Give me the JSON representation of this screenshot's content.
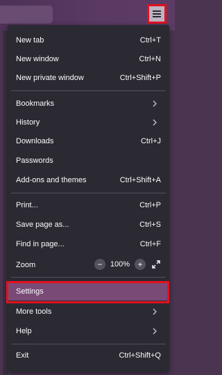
{
  "colors": {
    "accent_highlight": "#e5101e",
    "menu_bg": "#2b2a33",
    "selected_bg": "#7a4a77"
  },
  "toolbar": {
    "menu_icon": "hamburger-menu-icon"
  },
  "menu": {
    "new_tab": {
      "label": "New tab",
      "shortcut": "Ctrl+T"
    },
    "new_window": {
      "label": "New window",
      "shortcut": "Ctrl+N"
    },
    "new_private_window": {
      "label": "New private window",
      "shortcut": "Ctrl+Shift+P"
    },
    "bookmarks": {
      "label": "Bookmarks"
    },
    "history": {
      "label": "History"
    },
    "downloads": {
      "label": "Downloads",
      "shortcut": "Ctrl+J"
    },
    "passwords": {
      "label": "Passwords"
    },
    "addons": {
      "label": "Add-ons and themes",
      "shortcut": "Ctrl+Shift+A"
    },
    "print": {
      "label": "Print...",
      "shortcut": "Ctrl+P"
    },
    "save_page": {
      "label": "Save page as...",
      "shortcut": "Ctrl+S"
    },
    "find": {
      "label": "Find in page...",
      "shortcut": "Ctrl+F"
    },
    "zoom": {
      "label": "Zoom",
      "minus": "−",
      "value": "100%",
      "plus": "+"
    },
    "settings": {
      "label": "Settings"
    },
    "more_tools": {
      "label": "More tools"
    },
    "help": {
      "label": "Help"
    },
    "exit": {
      "label": "Exit",
      "shortcut": "Ctrl+Shift+Q"
    }
  }
}
